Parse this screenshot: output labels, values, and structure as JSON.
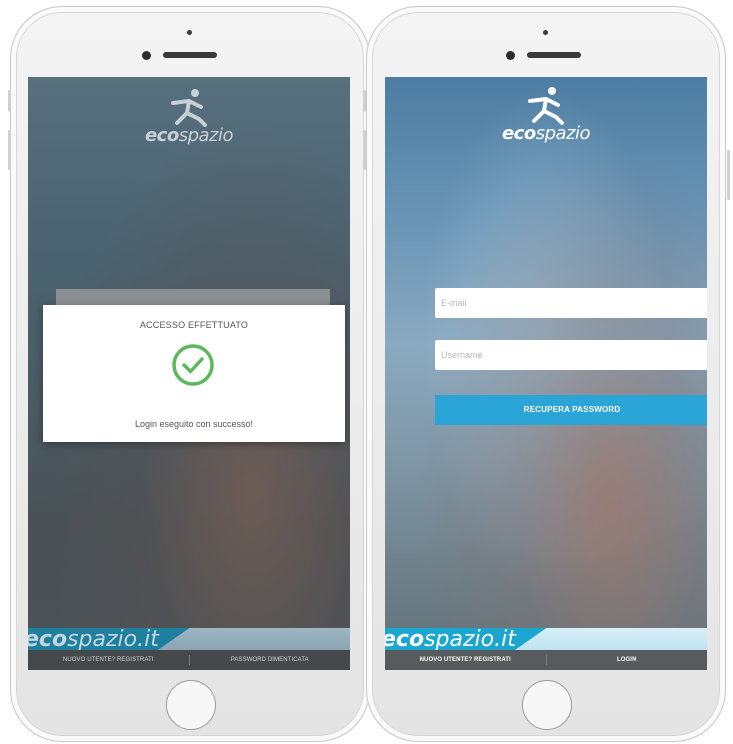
{
  "left_screen": {
    "logo_bold": "eco",
    "logo_rest": "spazio",
    "dialog": {
      "title": "ACCESSO EFFETTUATO",
      "message": "Login eseguito con successo!",
      "icon": "check-circle-icon",
      "icon_color": "#5cb85c"
    },
    "banner_bold": "eco",
    "banner_rest": "spazio.it",
    "footer": {
      "register_label": "NUOVO UTENTE? REGISTRATI",
      "forgot_label": "PASSWORD DIMENTICATA"
    }
  },
  "right_screen": {
    "logo_bold": "eco",
    "logo_rest": "spazio",
    "email_placeholder": "E-mail",
    "username_placeholder": "Username",
    "recover_button_label": "RECUPERA PASSWORD",
    "accent_color": "#2ba4d8",
    "banner_bold": "eco",
    "banner_rest": "spazio.it",
    "footer": {
      "register_label": "NUOVO UTENTE? REGISTRATI",
      "login_label": "LOGIN"
    }
  }
}
